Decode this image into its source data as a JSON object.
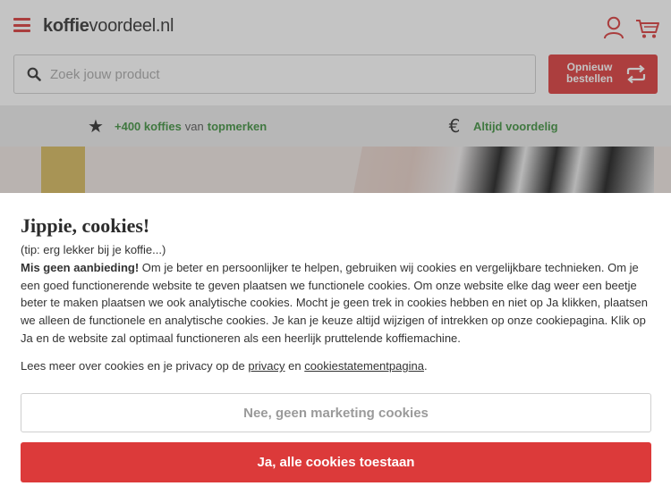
{
  "header": {
    "logo_bold": "koffie",
    "logo_rest": "voordeel.nl",
    "icons": [
      "menu-icon",
      "user-icon",
      "cart-icon"
    ]
  },
  "search": {
    "placeholder": "Zoek jouw product",
    "icon": "search-icon"
  },
  "reorder_button": {
    "line1": "Opnieuw",
    "line2": "bestellen",
    "icon": "reorder-icon"
  },
  "usp": {
    "item1": {
      "highlight": "+400 koffies",
      "middle": "van",
      "end": "topmerken",
      "icon": "star-icon"
    },
    "item2": {
      "text": "Altijd voordelig",
      "icon": "euro-icon"
    }
  },
  "cookie": {
    "title": "Jippie, cookies!",
    "tip": "(tip: erg lekker bij je koffie...)",
    "body_bold": "Mis geen aanbieding!",
    "body_text": " Om je beter en persoonlijker te helpen, gebruiken wij cookies en vergelijkbare technieken. Om je een goed functionerende website te geven plaatsen we functionele cookies. Om onze website elke dag weer een beetje beter te maken plaatsen we ook analytische cookies. Mocht je geen trek in cookies hebben en niet op Ja klikken, plaatsen we alleen de functionele en analytische cookies. Je kan je keuze altijd wijzigen of intrekken op onze cookiepagina. Klik op Ja en de website zal optimaal functioneren als een heerlijk pruttelende koffiemachine.",
    "more_prefix": "Lees meer over cookies en je privacy op de ",
    "privacy_link": "privacy",
    "more_and": " en ",
    "statement_link": "cookiestatementpagina",
    "more_suffix": ".",
    "decline_label": "Nee, geen marketing cookies",
    "accept_label": "Ja, alle cookies toestaan"
  },
  "colors": {
    "brand_red": "#dc3a3a",
    "usp_green": "#3d8f3d",
    "usp_bg": "#ececec"
  }
}
